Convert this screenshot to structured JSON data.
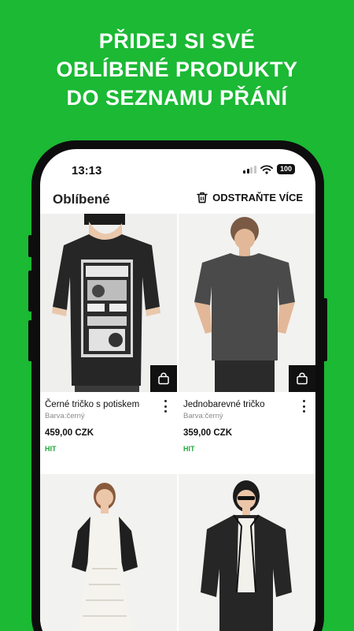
{
  "headline": {
    "line1": "PŘIDEJ SI SVÉ",
    "line2": "OBLÍBENÉ PRODUKTY",
    "line3": "DO SEZNAMU PŘÁNÍ"
  },
  "status_bar": {
    "time": "13:13",
    "battery": "100"
  },
  "app_bar": {
    "title": "Oblíbené",
    "remove_label": "ODSTRAŇTE VÍCE"
  },
  "products": [
    {
      "name": "Černé tričko s potiskem",
      "color": "Barva:černý",
      "price": "459,00 CZK",
      "badge": "HIT"
    },
    {
      "name": "Jednobarevné tričko",
      "color": "Barva:černý",
      "price": "359,00 CZK",
      "badge": "HIT"
    },
    {
      "name": "",
      "color": "",
      "price": "",
      "badge": ""
    },
    {
      "name": "",
      "color": "",
      "price": "",
      "badge": ""
    }
  ],
  "colors": {
    "background": "#1bb934",
    "accent_badge": "#1faa3c"
  },
  "icons": [
    "trash-icon",
    "shopping-bag-icon",
    "more-vertical-icon",
    "wifi-icon",
    "signal-icon"
  ]
}
